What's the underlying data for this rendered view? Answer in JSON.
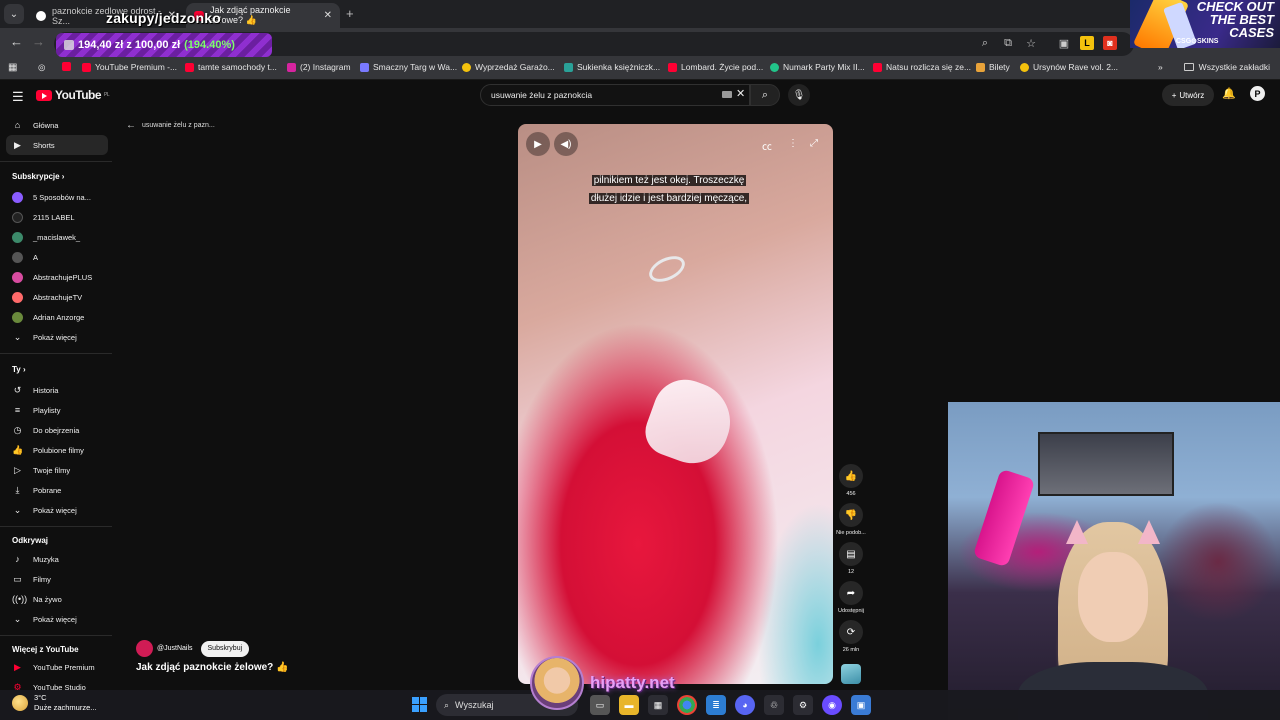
{
  "browser": {
    "tabs": [
      {
        "title": "paznokcie zedlowe odrost - Sz..."
      },
      {
        "title": "Jak zdjąć paznokcie żelowe? 👍"
      }
    ],
    "overlay_title": "zakupy/jedzonko",
    "price_badge": {
      "main": "194,40 zł z 100,00 zł",
      "pct": "(194.40%)"
    },
    "bookmarks": [
      "YouTube Premium -...",
      "tamte samochody t...",
      "(2) Instagram",
      "Smaczny Targ w Wa...",
      "Wyprzedaż Garażo...",
      "Sukienka księżniczk...",
      "Lombard. Życie pod...",
      "Numark Party Mix II...",
      "Natsu rozlicza się ze...",
      "Bilety",
      "Ursynów Rave vol. 2..."
    ],
    "bookmarks_all": "Wszystkie zakładki"
  },
  "ad": {
    "line1": "CHECK OUT",
    "line2": "THE BEST",
    "line3": "CASES",
    "brand": "CSG⊙SKINS"
  },
  "youtube": {
    "logo": "YouTube",
    "logo_region": "PL",
    "search_value": "usuwanie żelu z paznokcia",
    "create_label": "Utwórz",
    "avatar_letter": "P",
    "back_label": "usuwanie żelu z pazn...",
    "sidebar": {
      "main": [
        {
          "label": "Główna",
          "icon": "home-icon"
        },
        {
          "label": "Shorts",
          "icon": "shorts-icon"
        }
      ],
      "subs_header": "Subskrypcje",
      "subs": [
        {
          "label": "5 Sposobów na...",
          "color": "#8a5cff"
        },
        {
          "label": "2115 LABEL",
          "color": "#222222"
        },
        {
          "label": "_macislawek_",
          "color": "#3c8a6a"
        },
        {
          "label": "A",
          "color": "#555555"
        },
        {
          "label": "AbstrachujePLUS",
          "color": "#d84ca0"
        },
        {
          "label": "AbstrachujeTV",
          "color": "#ff6a6a"
        },
        {
          "label": "Adrian Anzorge",
          "color": "#6a8a3c"
        }
      ],
      "show_more": "Pokaż więcej",
      "you_header": "Ty",
      "you": [
        {
          "label": "Historia",
          "icon": "history-icon"
        },
        {
          "label": "Playlisty",
          "icon": "playlist-icon"
        },
        {
          "label": "Do obejrzenia",
          "icon": "clock-icon"
        },
        {
          "label": "Polubione filmy",
          "icon": "like-icon"
        },
        {
          "label": "Twoje filmy",
          "icon": "video-icon"
        },
        {
          "label": "Pobrane",
          "icon": "download-icon"
        }
      ],
      "explore_header": "Odkrywaj",
      "explore": [
        {
          "label": "Muzyka",
          "icon": "music-icon"
        },
        {
          "label": "Filmy",
          "icon": "film-icon"
        },
        {
          "label": "Na żywo",
          "icon": "live-icon"
        }
      ],
      "more_header": "Więcej z YouTube",
      "more": [
        {
          "label": "YouTube Premium"
        },
        {
          "label": "YouTube Studio"
        }
      ]
    },
    "video": {
      "caption_line1": "pilnikiem też jest okej. Troszeczkę",
      "caption_line2": "dłużej idzie i jest bardziej męczące,"
    },
    "actions": [
      {
        "label": "456",
        "icon": "like-icon"
      },
      {
        "label": "Nie podob...",
        "icon": "dislike-icon"
      },
      {
        "label": "12",
        "icon": "comment-icon"
      },
      {
        "label": "Udostępnij",
        "icon": "share-icon"
      },
      {
        "label": "26 mln",
        "icon": "remix-icon"
      }
    ],
    "channel": {
      "name": "@JustNails",
      "subscribe": "Subskrybuj"
    },
    "title": "Jak zdjąć paznokcie żelowe? 👍"
  },
  "watermark": "hipatty.net",
  "taskbar": {
    "weather_temp": "3°C",
    "weather_desc": "Duże zachmurze...",
    "search_placeholder": "Wyszukaj"
  }
}
